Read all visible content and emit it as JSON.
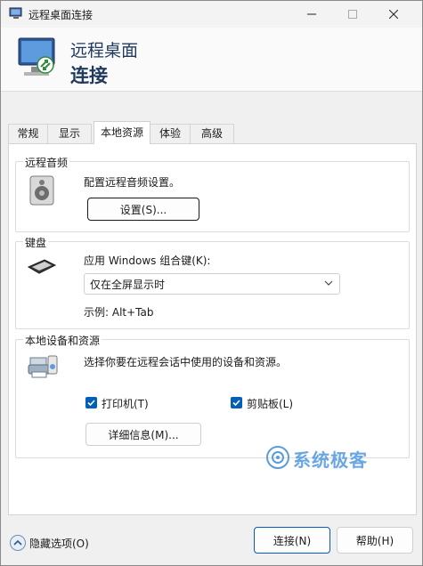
{
  "window": {
    "title": "远程桌面连接"
  },
  "header": {
    "line1": "远程桌面",
    "line2": "连接"
  },
  "tabs": [
    {
      "label": "常规"
    },
    {
      "label": "显示"
    },
    {
      "label": "本地资源",
      "active": true
    },
    {
      "label": "体验"
    },
    {
      "label": "高级"
    }
  ],
  "audio": {
    "title": "远程音频",
    "description": "配置远程音频设置。",
    "settings_button": "设置(S)..."
  },
  "keyboard": {
    "title": "键盘",
    "label": "应用 Windows 组合键(K):",
    "selected": "仅在全屏显示时",
    "example": "示例: Alt+Tab"
  },
  "devices": {
    "title": "本地设备和资源",
    "description": "选择你要在远程会话中使用的设备和资源。",
    "printer": {
      "label": "打印机(T)",
      "checked": true
    },
    "clipboard": {
      "label": "剪贴板(L)",
      "checked": true
    },
    "details_button": "详细信息(M)..."
  },
  "watermark": {
    "text": "系统极客"
  },
  "footer": {
    "hide_options": "隐藏选项(O)",
    "connect": "连接(N)",
    "help": "帮助(H)"
  },
  "colors": {
    "accent": "#005fb8",
    "title_blue": "#1f3a5e"
  }
}
